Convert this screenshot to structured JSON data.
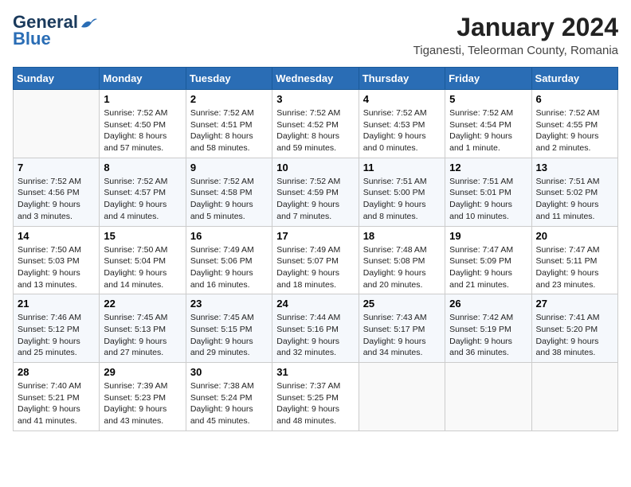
{
  "header": {
    "logo_line1": "General",
    "logo_line2": "Blue",
    "month_title": "January 2024",
    "location": "Tiganesti, Teleorman County, Romania"
  },
  "weekdays": [
    "Sunday",
    "Monday",
    "Tuesday",
    "Wednesday",
    "Thursday",
    "Friday",
    "Saturday"
  ],
  "weeks": [
    [
      {
        "day": "",
        "info": ""
      },
      {
        "day": "1",
        "info": "Sunrise: 7:52 AM\nSunset: 4:50 PM\nDaylight: 8 hours\nand 57 minutes."
      },
      {
        "day": "2",
        "info": "Sunrise: 7:52 AM\nSunset: 4:51 PM\nDaylight: 8 hours\nand 58 minutes."
      },
      {
        "day": "3",
        "info": "Sunrise: 7:52 AM\nSunset: 4:52 PM\nDaylight: 8 hours\nand 59 minutes."
      },
      {
        "day": "4",
        "info": "Sunrise: 7:52 AM\nSunset: 4:53 PM\nDaylight: 9 hours\nand 0 minutes."
      },
      {
        "day": "5",
        "info": "Sunrise: 7:52 AM\nSunset: 4:54 PM\nDaylight: 9 hours\nand 1 minute."
      },
      {
        "day": "6",
        "info": "Sunrise: 7:52 AM\nSunset: 4:55 PM\nDaylight: 9 hours\nand 2 minutes."
      }
    ],
    [
      {
        "day": "7",
        "info": "Sunrise: 7:52 AM\nSunset: 4:56 PM\nDaylight: 9 hours\nand 3 minutes."
      },
      {
        "day": "8",
        "info": "Sunrise: 7:52 AM\nSunset: 4:57 PM\nDaylight: 9 hours\nand 4 minutes."
      },
      {
        "day": "9",
        "info": "Sunrise: 7:52 AM\nSunset: 4:58 PM\nDaylight: 9 hours\nand 5 minutes."
      },
      {
        "day": "10",
        "info": "Sunrise: 7:52 AM\nSunset: 4:59 PM\nDaylight: 9 hours\nand 7 minutes."
      },
      {
        "day": "11",
        "info": "Sunrise: 7:51 AM\nSunset: 5:00 PM\nDaylight: 9 hours\nand 8 minutes."
      },
      {
        "day": "12",
        "info": "Sunrise: 7:51 AM\nSunset: 5:01 PM\nDaylight: 9 hours\nand 10 minutes."
      },
      {
        "day": "13",
        "info": "Sunrise: 7:51 AM\nSunset: 5:02 PM\nDaylight: 9 hours\nand 11 minutes."
      }
    ],
    [
      {
        "day": "14",
        "info": "Sunrise: 7:50 AM\nSunset: 5:03 PM\nDaylight: 9 hours\nand 13 minutes."
      },
      {
        "day": "15",
        "info": "Sunrise: 7:50 AM\nSunset: 5:04 PM\nDaylight: 9 hours\nand 14 minutes."
      },
      {
        "day": "16",
        "info": "Sunrise: 7:49 AM\nSunset: 5:06 PM\nDaylight: 9 hours\nand 16 minutes."
      },
      {
        "day": "17",
        "info": "Sunrise: 7:49 AM\nSunset: 5:07 PM\nDaylight: 9 hours\nand 18 minutes."
      },
      {
        "day": "18",
        "info": "Sunrise: 7:48 AM\nSunset: 5:08 PM\nDaylight: 9 hours\nand 20 minutes."
      },
      {
        "day": "19",
        "info": "Sunrise: 7:47 AM\nSunset: 5:09 PM\nDaylight: 9 hours\nand 21 minutes."
      },
      {
        "day": "20",
        "info": "Sunrise: 7:47 AM\nSunset: 5:11 PM\nDaylight: 9 hours\nand 23 minutes."
      }
    ],
    [
      {
        "day": "21",
        "info": "Sunrise: 7:46 AM\nSunset: 5:12 PM\nDaylight: 9 hours\nand 25 minutes."
      },
      {
        "day": "22",
        "info": "Sunrise: 7:45 AM\nSunset: 5:13 PM\nDaylight: 9 hours\nand 27 minutes."
      },
      {
        "day": "23",
        "info": "Sunrise: 7:45 AM\nSunset: 5:15 PM\nDaylight: 9 hours\nand 29 minutes."
      },
      {
        "day": "24",
        "info": "Sunrise: 7:44 AM\nSunset: 5:16 PM\nDaylight: 9 hours\nand 32 minutes."
      },
      {
        "day": "25",
        "info": "Sunrise: 7:43 AM\nSunset: 5:17 PM\nDaylight: 9 hours\nand 34 minutes."
      },
      {
        "day": "26",
        "info": "Sunrise: 7:42 AM\nSunset: 5:19 PM\nDaylight: 9 hours\nand 36 minutes."
      },
      {
        "day": "27",
        "info": "Sunrise: 7:41 AM\nSunset: 5:20 PM\nDaylight: 9 hours\nand 38 minutes."
      }
    ],
    [
      {
        "day": "28",
        "info": "Sunrise: 7:40 AM\nSunset: 5:21 PM\nDaylight: 9 hours\nand 41 minutes."
      },
      {
        "day": "29",
        "info": "Sunrise: 7:39 AM\nSunset: 5:23 PM\nDaylight: 9 hours\nand 43 minutes."
      },
      {
        "day": "30",
        "info": "Sunrise: 7:38 AM\nSunset: 5:24 PM\nDaylight: 9 hours\nand 45 minutes."
      },
      {
        "day": "31",
        "info": "Sunrise: 7:37 AM\nSunset: 5:25 PM\nDaylight: 9 hours\nand 48 minutes."
      },
      {
        "day": "",
        "info": ""
      },
      {
        "day": "",
        "info": ""
      },
      {
        "day": "",
        "info": ""
      }
    ]
  ]
}
